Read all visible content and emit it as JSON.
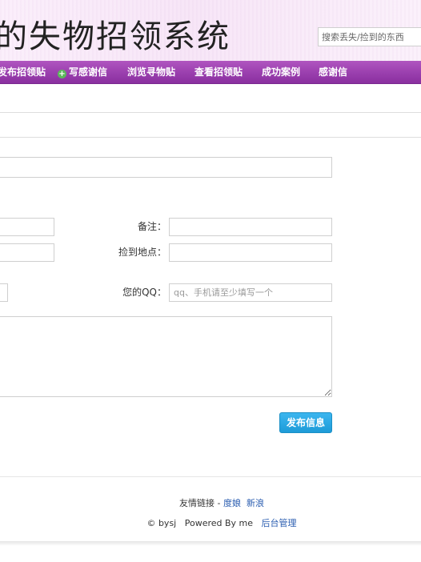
{
  "header": {
    "site_title": "的失物招领系统",
    "search_placeholder": "搜索丢失/捡到的东西"
  },
  "nav": {
    "items": [
      {
        "label": "发布招领贴"
      },
      {
        "label": "写感谢信",
        "icon": "plus-circle-icon"
      },
      {
        "label": "浏览寻物贴"
      },
      {
        "label": "查看招领贴"
      },
      {
        "label": "成功案例"
      },
      {
        "label": "感谢信"
      }
    ]
  },
  "form": {
    "remark_label": "备注：",
    "pickup_location_label": "捡到地点：",
    "qq_label": "您的QQ：",
    "qq_placeholder": "qq、手机请至少填写一个",
    "submit_label": "发布信息"
  },
  "footer": {
    "links_label": "友情链接 - ",
    "links": [
      "度娘",
      "新浪"
    ],
    "copyright": "© bysj",
    "powered": "Powered By me",
    "admin_link": "后台管理"
  },
  "colors": {
    "nav_bg": "#9a3fae",
    "header_bg": "#f7e6f7",
    "button_blue": "#1d9bd8",
    "link_blue": "#2a5db0"
  }
}
